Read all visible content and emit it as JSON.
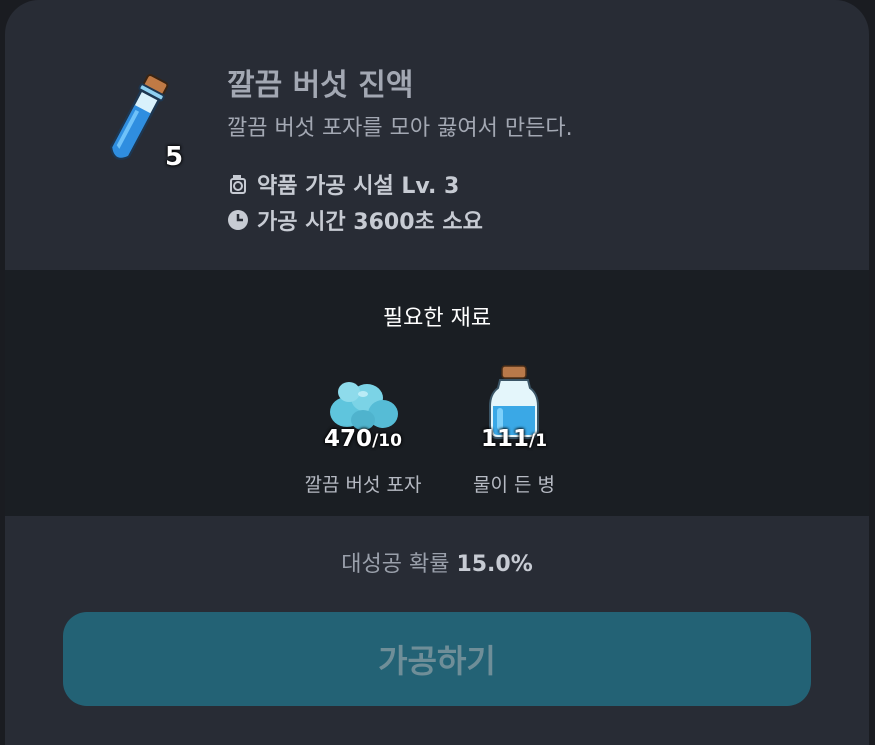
{
  "item": {
    "name": "깔끔 버섯 진액",
    "description": "깔끔 버섯 포자를 모아 끓여서 만든다.",
    "count": "5",
    "icon": "blue-potion-tube-icon",
    "facility": "약품 가공 시설 Lv. 3",
    "time": "가공 시간 3600초 소요"
  },
  "materials": {
    "title": "필요한 재료",
    "items": [
      {
        "name": "깔끔 버섯 포자",
        "owned": "470",
        "required": "/10",
        "icon": "blue-spores-icon"
      },
      {
        "name": "물이 든 병",
        "owned": "111",
        "required": "/1",
        "icon": "water-bottle-icon"
      }
    ]
  },
  "success": {
    "label": "대성공 확률",
    "value": "15.0%"
  },
  "button": {
    "label": "가공하기"
  },
  "colors": {
    "panel": "#282c35",
    "materials_bg": "#1a1e23",
    "button": "#236275"
  }
}
